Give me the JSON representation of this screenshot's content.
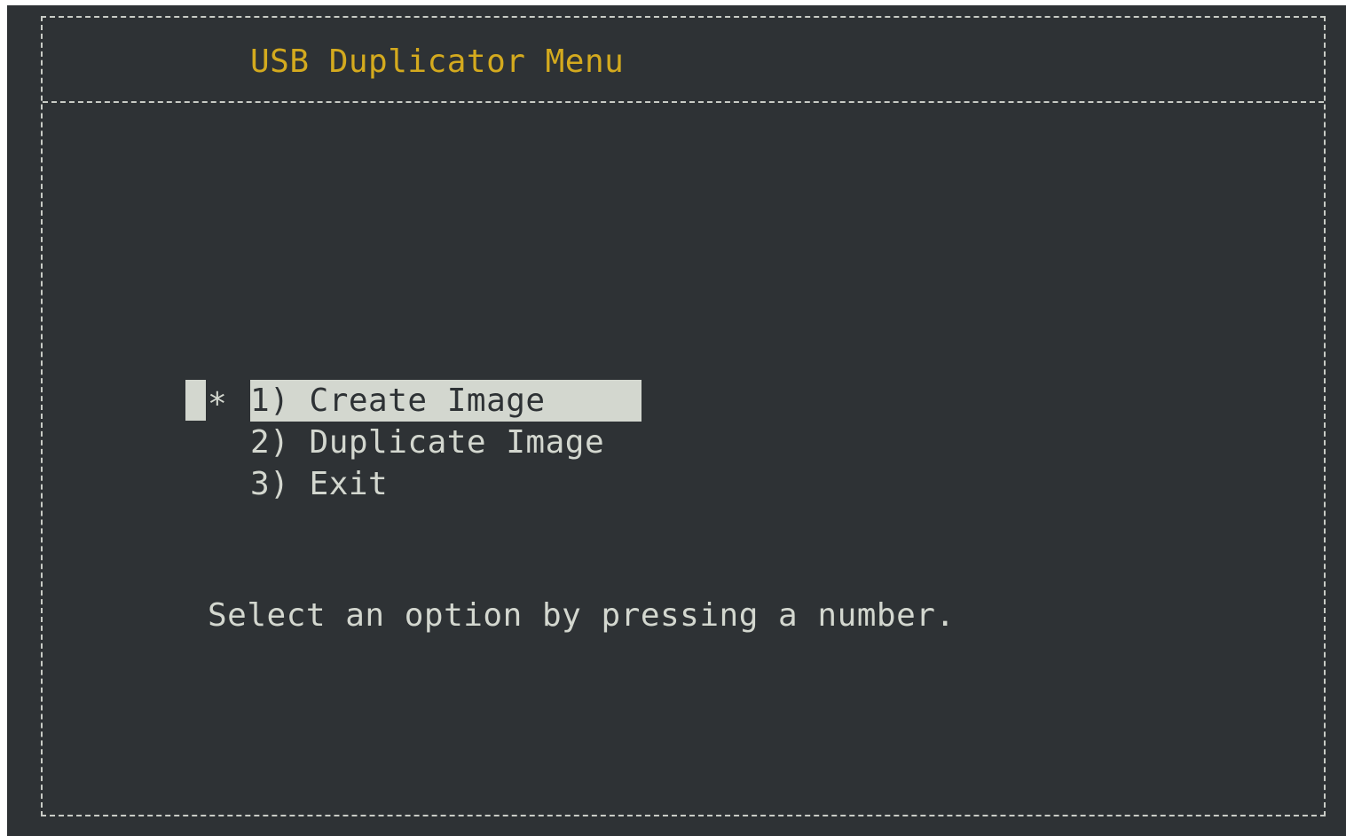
{
  "window": {
    "title": "USB Duplicator Menu"
  },
  "menu": {
    "marker": "*",
    "items": [
      {
        "label": "1) Create Image",
        "selected": true
      },
      {
        "label": "2) Duplicate Image",
        "selected": false
      },
      {
        "label": "3) Exit",
        "selected": false
      }
    ]
  },
  "hint": "Select an option by pressing a number.",
  "colors": {
    "background": "#2e3235",
    "title": "#d4aa1e",
    "text": "#d3d7cf",
    "border": "#c9ccc6",
    "highlight": "#d3d7cf"
  }
}
